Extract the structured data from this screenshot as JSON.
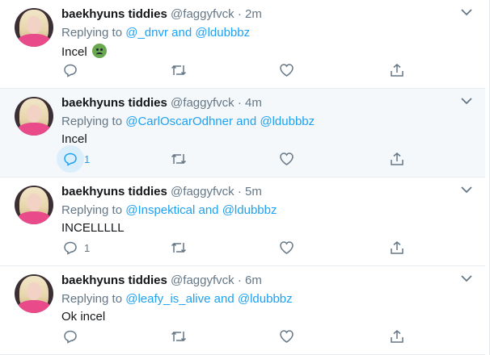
{
  "tweets": [
    {
      "name": "baekhyuns tiddies",
      "handle": "@faggyfvck",
      "sep": "·",
      "time": "2m",
      "replying_prefix": "Replying to",
      "replying_links": [
        "@_dnvr",
        "@ldubbbz"
      ],
      "and": "and",
      "text": "Incel",
      "emoji": "nauseated-face-emoji",
      "reply_count": "",
      "highlighted": false
    },
    {
      "name": "baekhyuns tiddies",
      "handle": "@faggyfvck",
      "sep": "·",
      "time": "4m",
      "replying_prefix": "Replying to",
      "replying_links": [
        "@CarlOscarOdhner",
        "@ldubbbz"
      ],
      "and": "and",
      "text": "Incel",
      "reply_count": "1",
      "highlighted": true
    },
    {
      "name": "baekhyuns tiddies",
      "handle": "@faggyfvck",
      "sep": "·",
      "time": "5m",
      "replying_prefix": "Replying to",
      "replying_links": [
        "@Inspektical",
        "@ldubbbz"
      ],
      "and": "and",
      "text": "INCELLLLL",
      "reply_count": "1",
      "highlighted": false
    },
    {
      "name": "baekhyuns tiddies",
      "handle": "@faggyfvck",
      "sep": "·",
      "time": "6m",
      "replying_prefix": "Replying to",
      "replying_links": [
        "@leafy_is_alive",
        "@ldubbbz"
      ],
      "and": "and",
      "text": "Ok incel",
      "reply_count": "",
      "highlighted": false
    }
  ],
  "icons": {
    "reply": "reply-icon",
    "retweet": "retweet-icon",
    "like": "like-icon",
    "share": "share-icon",
    "menu": "chevron-down-icon"
  },
  "colors": {
    "link": "#1da1f2",
    "muted": "#657786",
    "highlight_bg": "#f5f8fa"
  }
}
